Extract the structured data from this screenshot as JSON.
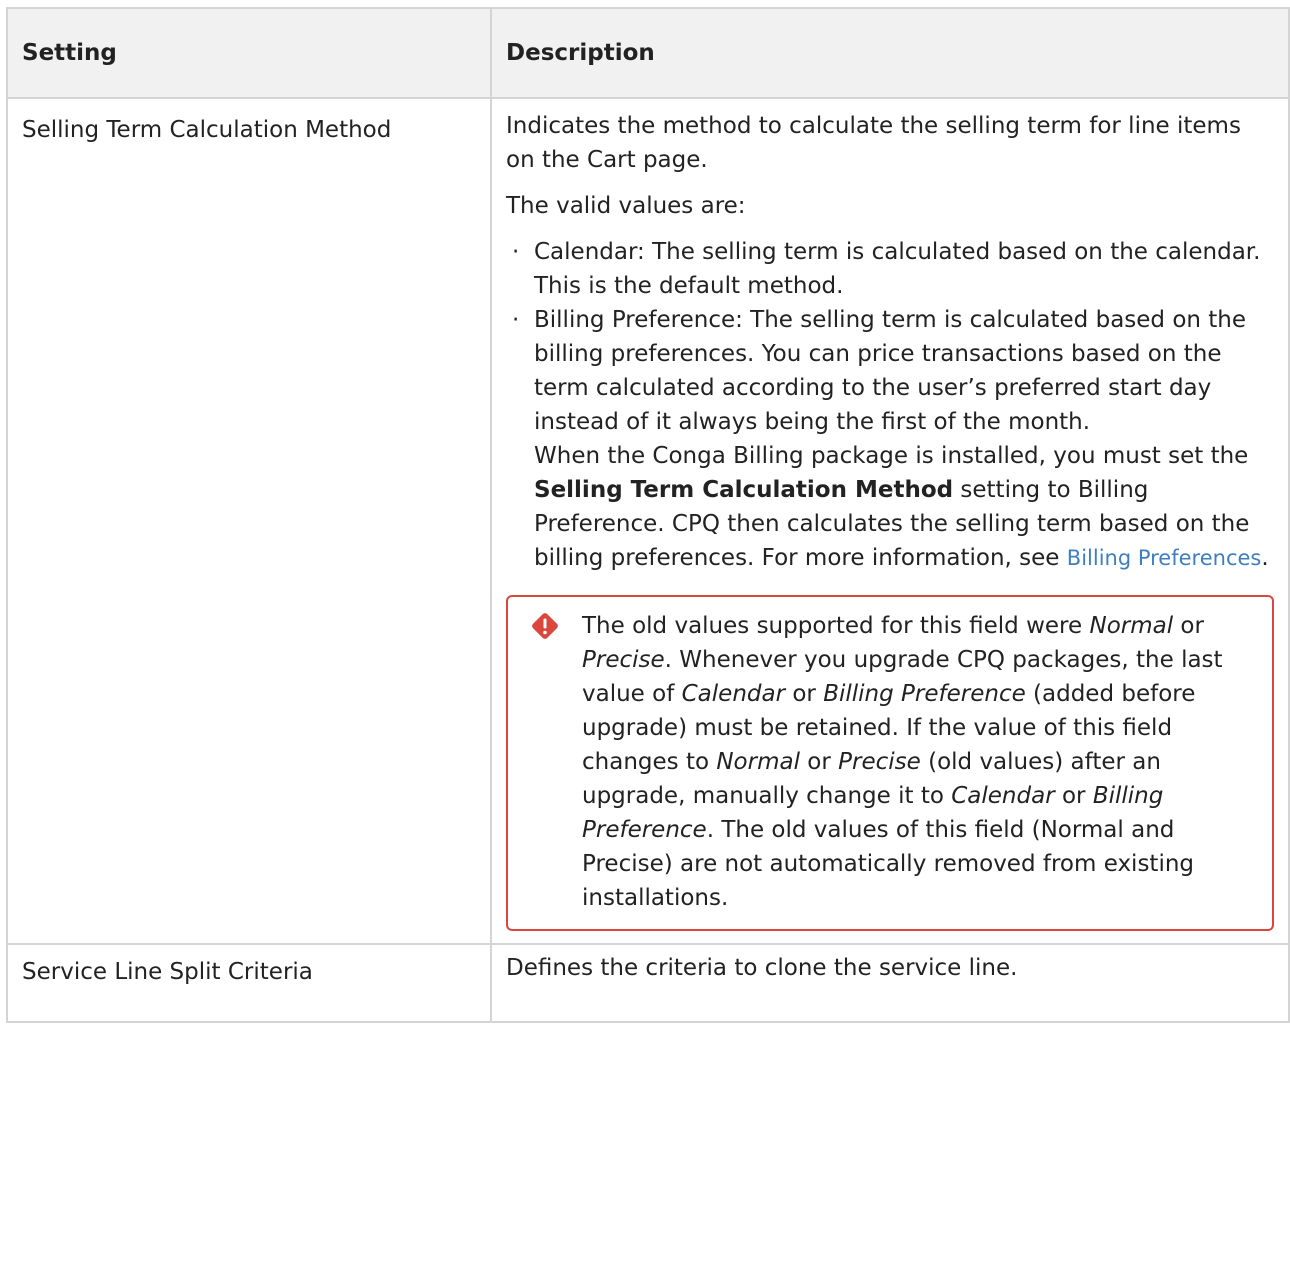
{
  "table": {
    "headers": {
      "setting": "Setting",
      "description": "Description"
    },
    "row1": {
      "setting": "Selling Term Calculation Method",
      "intro": "Indicates the method to calculate the selling term for line items on the Cart page.",
      "valid_values_label": "The valid values are:",
      "calendar_item": "Calendar: The selling term is calculated based on the calendar. This is the default method.",
      "billing_item": "Billing Preference: The selling term is calculated based on the billing preferences. You can price transactions based on the term calculated according to the user’s preferred start day instead of it always being the first of the month.",
      "billing_note_a": "When the Conga Billing package is installed, you must set the ",
      "billing_note_bold": "Selling Term Calculation Method",
      "billing_note_b": " setting to Billing Preference. CPQ then calculates the selling term based on the billing preferences. For more information, see ",
      "billing_link": "Billing Preferences",
      "billing_note_end": ".",
      "alert": {
        "icon": "alert-diamond-icon",
        "color": "#d9473d",
        "s1": "The old values supported for this field were ",
        "e1": "Normal",
        "s2": " or ",
        "e2": "Precise",
        "s3": ". Whenever you upgrade CPQ packages, the last value of ",
        "e3": "Calendar",
        "s4": " or ",
        "e4": "Billing Preference",
        "s5": " (added before upgrade) must be retained. If the value of this field changes to ",
        "e5": "Normal",
        "s6": " or ",
        "e6": "Precise",
        "s7": " (old values) after an upgrade, manually change it to ",
        "e7": "Calendar",
        "s8": " or ",
        "e8": "Billing Preference",
        "s9": ". The old values of this field (Normal and Precise) are not automatically removed from existing installations."
      }
    },
    "row2": {
      "setting": "Service Line Split Criteria",
      "description": "Defines the criteria to clone the service line."
    }
  },
  "colors": {
    "link": "#3f7fbf",
    "header_bg": "#f1f1f1",
    "border": "#d4d4d4"
  }
}
